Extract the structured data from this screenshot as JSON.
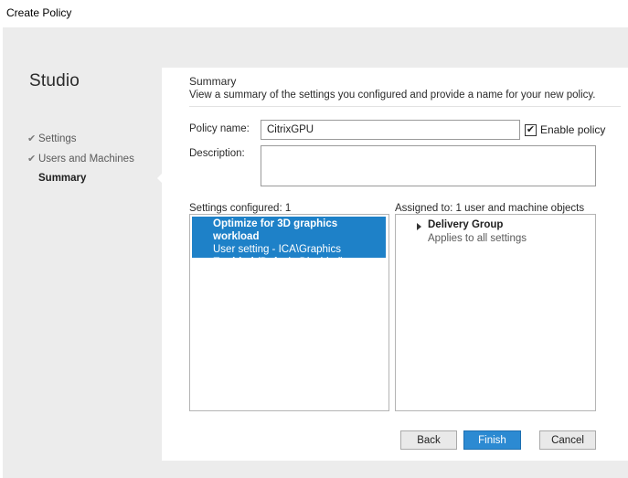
{
  "window": {
    "title": "Create Policy"
  },
  "nav": {
    "brand": "Studio",
    "steps": [
      {
        "label": "Settings",
        "state": "completed"
      },
      {
        "label": "Users and Machines",
        "state": "completed"
      },
      {
        "label": "Summary",
        "state": "current"
      }
    ],
    "check_glyph": "✔"
  },
  "summary": {
    "heading": "Summary",
    "instruction": "View a summary of the settings you configured and provide a name for your new policy.",
    "policy_name_label": "Policy name:",
    "policy_name_value": "CitrixGPU",
    "enable_policy_label": "Enable policy",
    "enable_policy_checked": true,
    "description_label": "Description:",
    "description_value": "",
    "settings_configured_label": "Settings configured: 1",
    "settings": [
      {
        "name": "Optimize for 3D graphics workload",
        "path": "User setting - ICA\\Graphics",
        "state": "Enabled",
        "default": "(Default: Disabled)"
      }
    ],
    "assigned_to_label": "Assigned to: 1 user and machine objects",
    "assignments": [
      {
        "name": "Delivery Group",
        "detail": "Applies to all settings"
      }
    ]
  },
  "buttons": {
    "back": "Back",
    "finish": "Finish",
    "cancel": "Cancel"
  },
  "colors": {
    "accent": "#1e81c8",
    "primary_button": "#2c8ad2",
    "nav_bg": "#ececec"
  }
}
